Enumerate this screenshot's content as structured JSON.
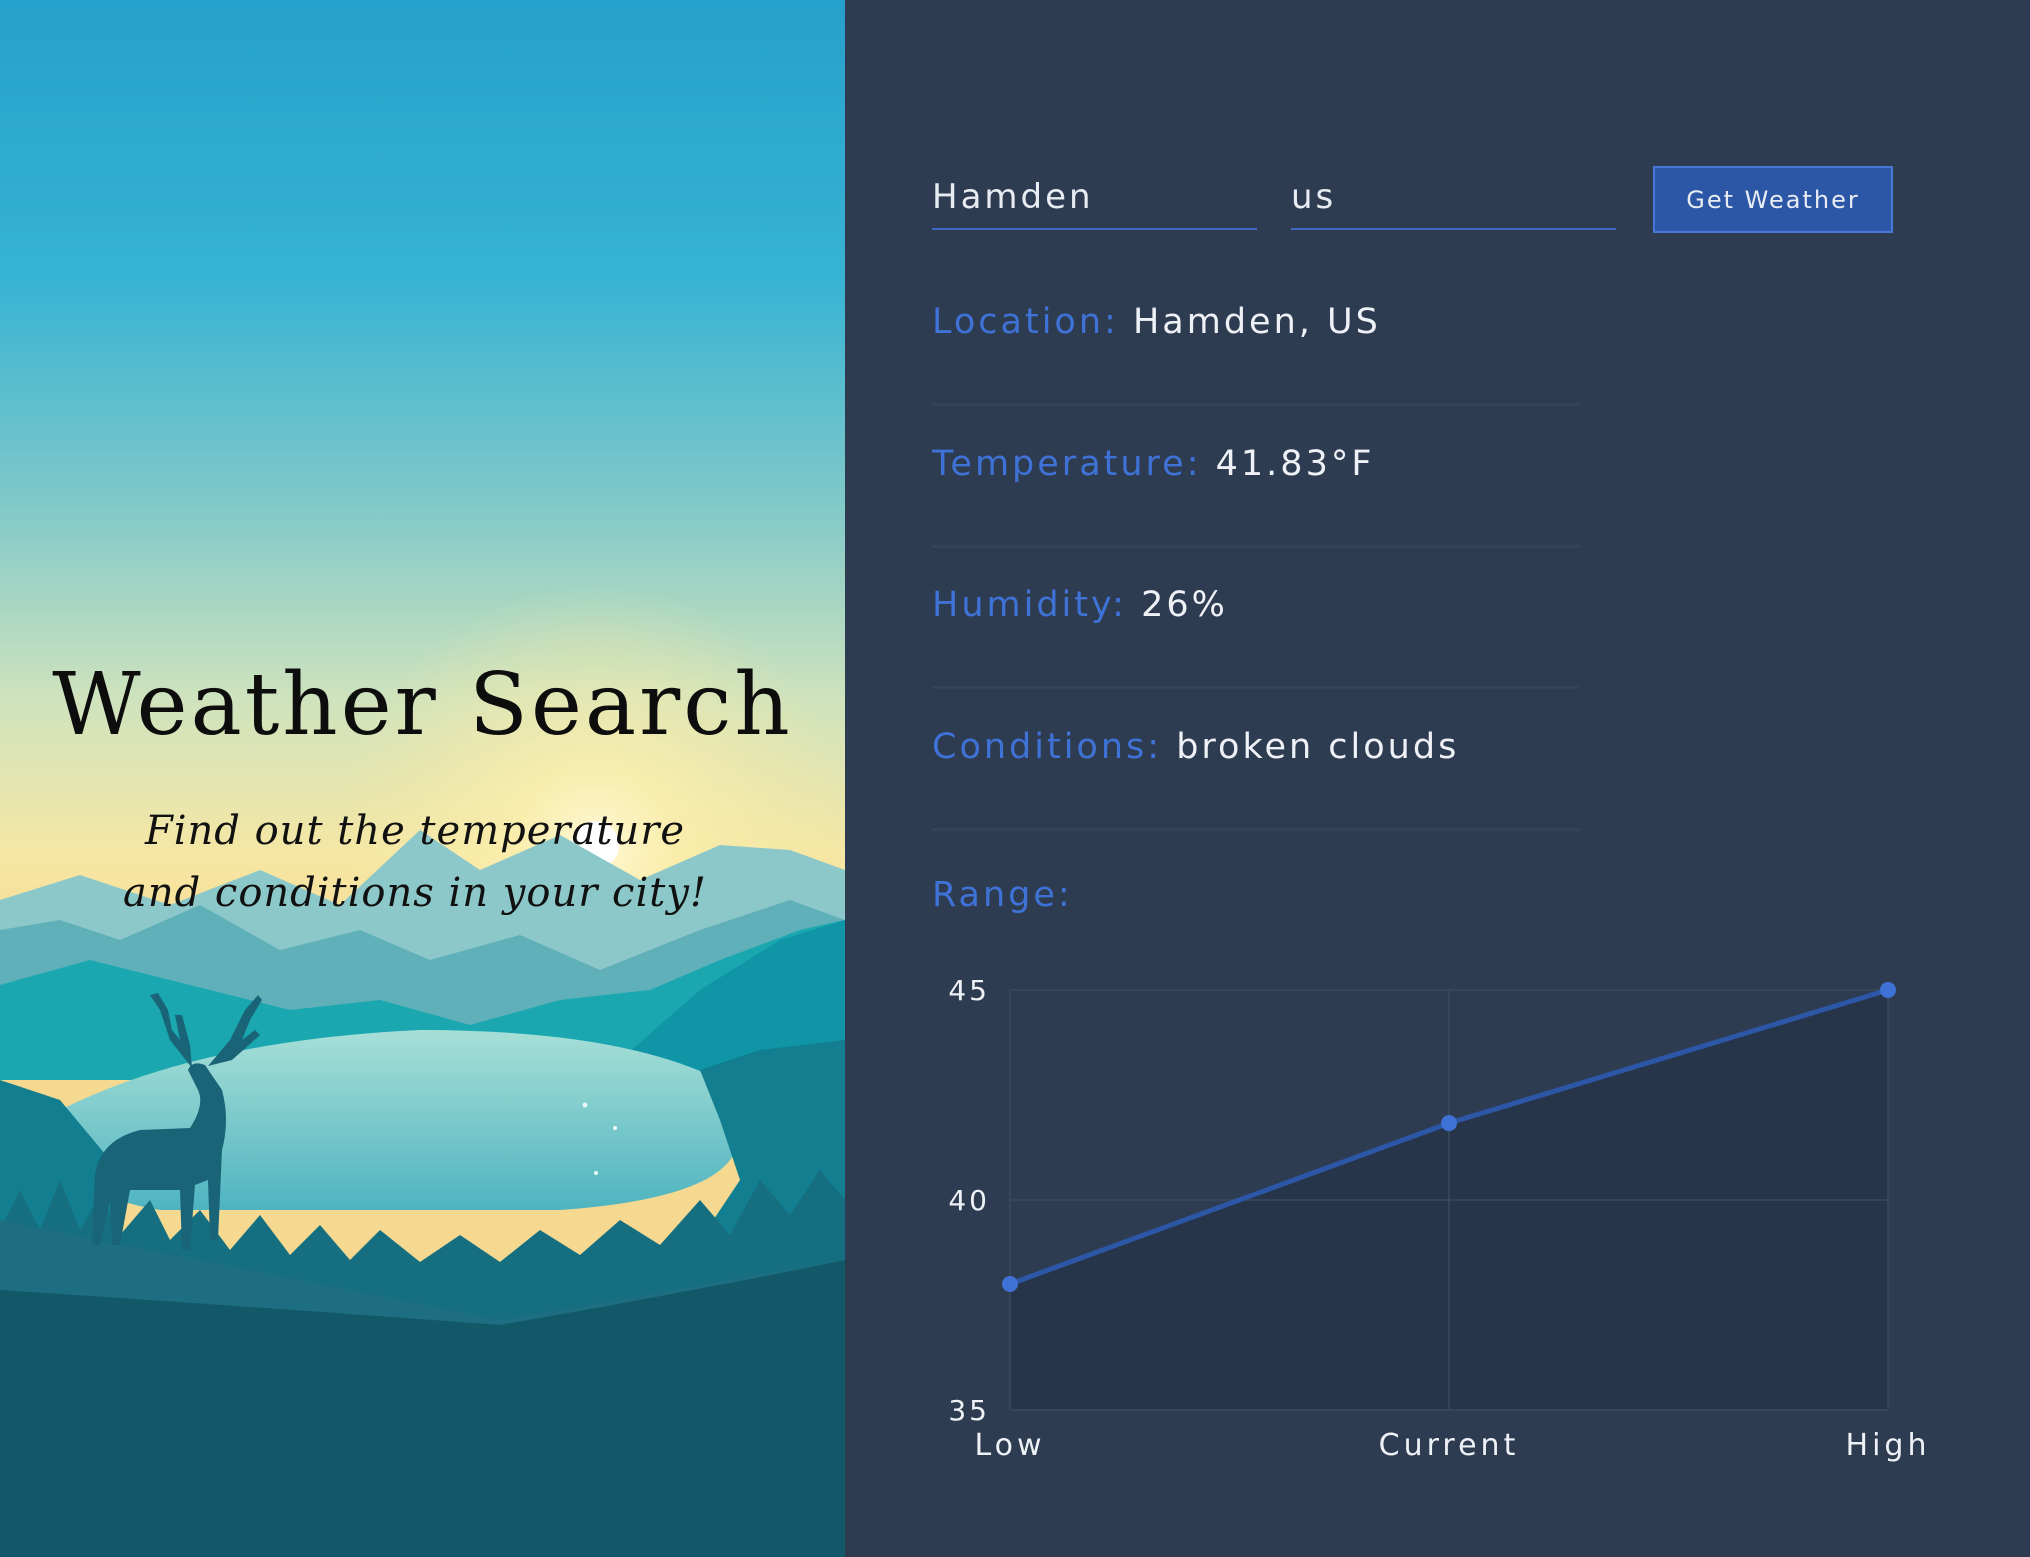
{
  "hero": {
    "title": "Weather Search",
    "subtitle_line1": "Find out the temperature",
    "subtitle_line2": "and conditions in your city!"
  },
  "search": {
    "city_value": "Hamden",
    "country_value": "us",
    "button_label": "Get Weather"
  },
  "results": {
    "location_label": "Location:",
    "location_value": "Hamden, US",
    "temperature_label": "Temperature:",
    "temperature_value": "41.83°F",
    "humidity_label": "Humidity:",
    "humidity_value": "26%",
    "conditions_label": "Conditions:",
    "conditions_value": "broken clouds",
    "range_label": "Range:"
  },
  "colors": {
    "panel_bg": "#2e3c51",
    "accent": "#3f72d6",
    "line": "#2c56a6",
    "text": "#eef1f5"
  },
  "chart_data": {
    "type": "area",
    "categories": [
      "Low",
      "Current",
      "High"
    ],
    "series": [
      {
        "values": [
          38,
          41.83,
          45
        ]
      }
    ],
    "yticks": [
      35,
      40,
      45
    ],
    "ylim": [
      35,
      45
    ],
    "grid": true
  }
}
